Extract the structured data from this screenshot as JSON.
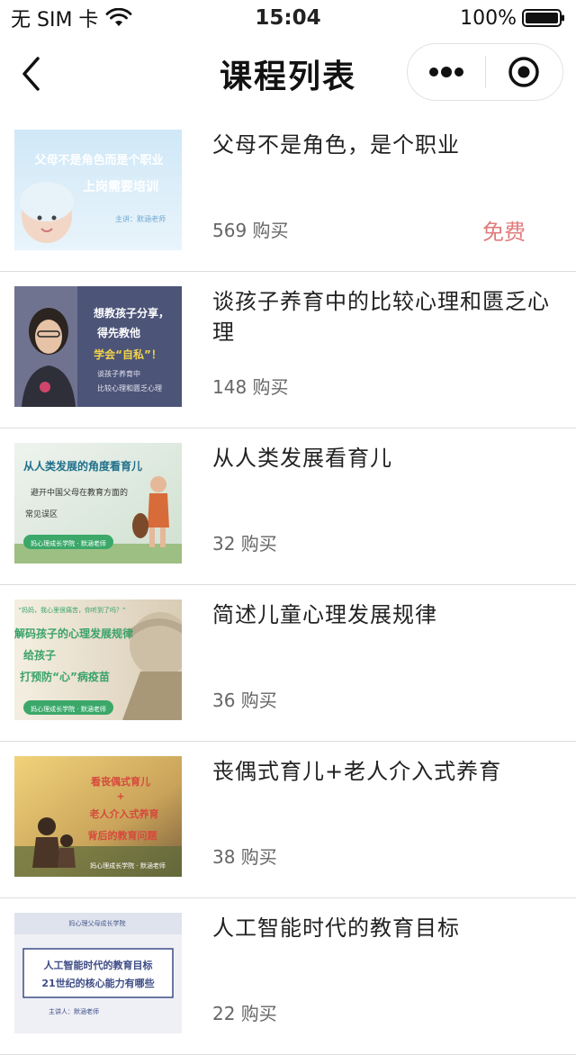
{
  "status_bar": {
    "carrier": "无 SIM 卡",
    "time": "15:04",
    "battery": "100%"
  },
  "nav": {
    "title": "课程列表",
    "back_icon": "chevron-left-icon",
    "more_icon": "more-dots-icon",
    "close_icon": "target-circle-icon"
  },
  "colors": {
    "price_free": "#e07c7c",
    "divider": "#dddddd"
  },
  "courses": [
    {
      "title": "父母不是角色，是个职业",
      "count": "569 购买",
      "price": "免费",
      "thumb": {
        "line1": "父母不是角色而是个职业",
        "line2": "上岗需要培训",
        "line3": "主讲：默涵老师"
      }
    },
    {
      "title": "谈孩子养育中的比较心理和匮乏心理",
      "count": "148 购买",
      "price": "",
      "thumb": {
        "line1": "想教孩子分享，",
        "line2": "得先教他",
        "line3": "学会“自私”！",
        "line4": "谈孩子养育中",
        "line5": "比较心理和匮乏心理"
      }
    },
    {
      "title": "从人类发展看育儿",
      "count": "32 购买",
      "price": "",
      "thumb": {
        "line1": "从人类发展的角度看育儿",
        "line2": "避开中国父母在教育方面的",
        "line3": "常见误区",
        "line4": "妈心理成长学院 · 默涵老师"
      }
    },
    {
      "title": "简述儿童心理发展规律",
      "count": "36 购买",
      "price": "",
      "thumb": {
        "line1": "“妈妈，我心里很痛苦，你听到了吗？”",
        "line2": "解码孩子的心理发展规律",
        "line3": "给孩子",
        "line4": "打预防“心”病疫苗",
        "line5": "妈心理成长学院 · 默涵老师"
      }
    },
    {
      "title": "丧偶式育儿+老人介入式养育",
      "count": "38 购买",
      "price": "",
      "thumb": {
        "line1": "看丧偶式育儿",
        "line2": "+",
        "line3": "老人介入式养育",
        "line4": "背后的教育问题",
        "line5": "妈心理成长学院 · 默涵老师"
      }
    },
    {
      "title": "人工智能时代的教育目标",
      "count": "22 购买",
      "price": "",
      "thumb": {
        "line1": "妈心理父母成长学院",
        "line2": "人工智能时代的教育目标",
        "line3": "21世纪的核心能力有哪些",
        "line4": "主讲人：默涵老师"
      }
    }
  ]
}
